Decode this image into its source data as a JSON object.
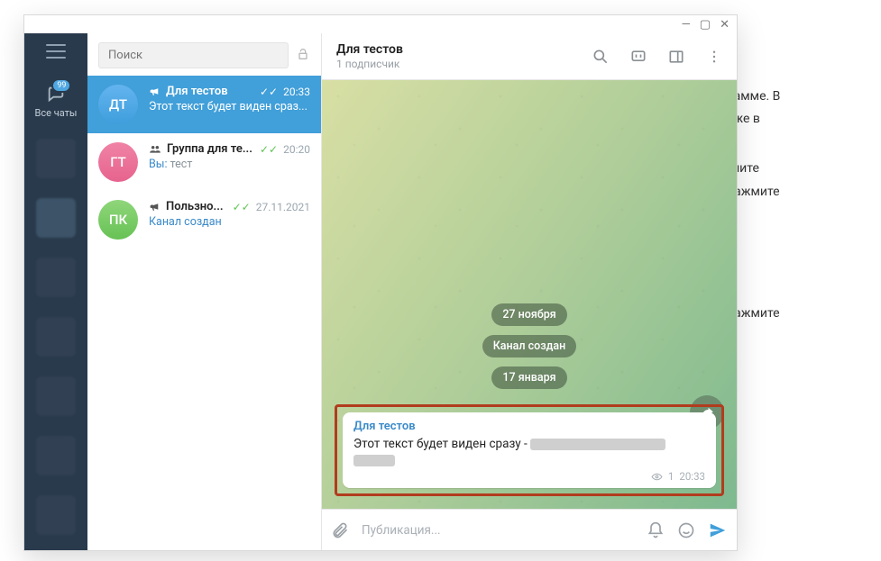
{
  "window_controls": {
    "min": "—",
    "max": "▢",
    "close": "✕"
  },
  "rail": {
    "badge": "99",
    "all_chats": "Все чаты"
  },
  "search": {
    "placeholder": "Поиск"
  },
  "chats": [
    {
      "avatar": "ДТ",
      "name": "Для тестов",
      "time": "20:33",
      "preview": "Этот текст будет виден сраз..."
    },
    {
      "avatar": "ГТ",
      "name": "Группа для те...",
      "time": "20:20",
      "you": "Вы:",
      "preview": "тест"
    },
    {
      "avatar": "ПК",
      "name": "Пользно...",
      "time": "27.11.2021",
      "preview": "Канал создан"
    }
  ],
  "header": {
    "title": "Для тестов",
    "subtitle": "1 подписчик"
  },
  "pills": {
    "date1": "27 ноября",
    "service": "Канал создан",
    "date2": "17 января"
  },
  "message": {
    "sender": "Для тестов",
    "text_prefix": "Этот текст будет виден сразу - ",
    "views": "1",
    "time": "20:33"
  },
  "composer": {
    "placeholder": "Публикация..."
  },
  "bg": {
    "l1": "елеграмме. В",
    "l2": "а так же в",
    "l3": "напишите",
    "l4": "ст и нажмите",
    "l5": "ст и нажмите"
  }
}
